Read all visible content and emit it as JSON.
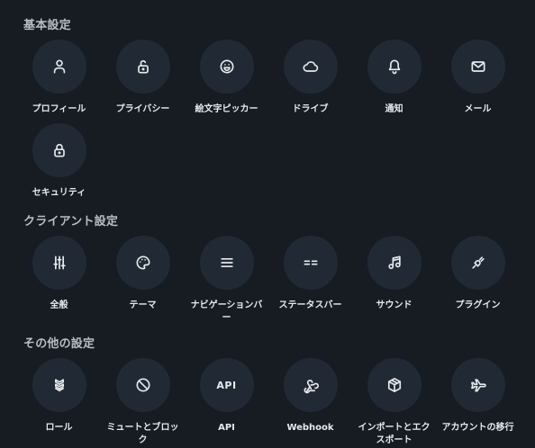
{
  "sections": [
    {
      "title": "基本設定",
      "items": [
        {
          "label": "プロフィール",
          "icon": "user-icon"
        },
        {
          "label": "プライバシー",
          "icon": "lock-open-icon"
        },
        {
          "label": "絵文字ピッカー",
          "icon": "smile-icon"
        },
        {
          "label": "ドライブ",
          "icon": "cloud-icon"
        },
        {
          "label": "通知",
          "icon": "bell-icon"
        },
        {
          "label": "メール",
          "icon": "mail-icon"
        },
        {
          "label": "セキュリティ",
          "icon": "lock-icon"
        }
      ]
    },
    {
      "title": "クライアント設定",
      "items": [
        {
          "label": "全般",
          "icon": "sliders-icon"
        },
        {
          "label": "テーマ",
          "icon": "palette-icon"
        },
        {
          "label": "ナビゲーションバー",
          "icon": "menu-icon"
        },
        {
          "label": "ステータスバー",
          "icon": "equal-icon"
        },
        {
          "label": "サウンド",
          "icon": "music-icon"
        },
        {
          "label": "プラグイン",
          "icon": "plug-icon"
        }
      ]
    },
    {
      "title": "その他の設定",
      "items": [
        {
          "label": "ロール",
          "icon": "badges-icon"
        },
        {
          "label": "ミュートとブロック",
          "icon": "ban-icon"
        },
        {
          "label": "API",
          "icon": "api-icon",
          "icon_text": "API"
        },
        {
          "label": "Webhook",
          "icon": "webhook-icon"
        },
        {
          "label": "インポートとエクスポート",
          "icon": "package-icon"
        },
        {
          "label": "アカウントの移行",
          "icon": "plane-icon"
        }
      ]
    }
  ]
}
